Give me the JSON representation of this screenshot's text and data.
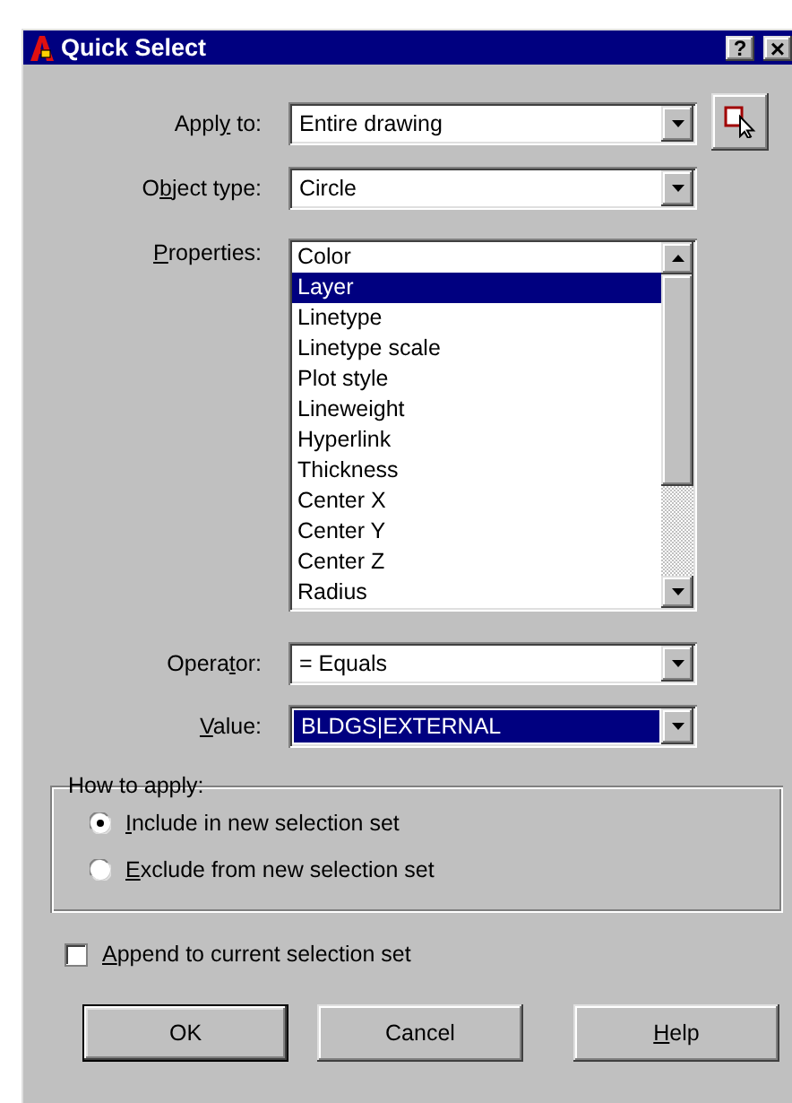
{
  "window": {
    "title": "Quick Select",
    "help_glyph": "?",
    "close_glyph": "×"
  },
  "fields": [
    {
      "kind": "combo",
      "label": [
        {
          "text": "Appl",
          "underline": false
        },
        {
          "text": "y",
          "underline": true
        },
        {
          "text": " to:",
          "underline": false
        }
      ],
      "value": "Entire drawing",
      "highlighted": false,
      "pick_button": true
    },
    {
      "kind": "combo",
      "label": [
        {
          "text": "O",
          "underline": false
        },
        {
          "text": "b",
          "underline": true
        },
        {
          "text": "ject type:",
          "underline": false
        }
      ],
      "value": "Circle",
      "highlighted": false,
      "pick_button": false
    },
    {
      "kind": "list",
      "label": [
        {
          "text": "P",
          "underline": true
        },
        {
          "text": "roperties:",
          "underline": false
        }
      ],
      "items": [
        {
          "text": "Color",
          "selected": false
        },
        {
          "text": "Layer",
          "selected": true
        },
        {
          "text": "Linetype",
          "selected": false
        },
        {
          "text": "Linetype scale",
          "selected": false
        },
        {
          "text": "Plot style",
          "selected": false
        },
        {
          "text": "Lineweight",
          "selected": false
        },
        {
          "text": "Hyperlink",
          "selected": false
        },
        {
          "text": "Thickness",
          "selected": false
        },
        {
          "text": "Center X",
          "selected": false
        },
        {
          "text": "Center Y",
          "selected": false
        },
        {
          "text": "Center Z",
          "selected": false
        },
        {
          "text": "Radius",
          "selected": false
        }
      ]
    },
    {
      "kind": "combo",
      "label": [
        {
          "text": "Opera",
          "underline": false
        },
        {
          "text": "t",
          "underline": true
        },
        {
          "text": "or:",
          "underline": false
        }
      ],
      "value": "= Equals",
      "highlighted": false,
      "pick_button": false
    },
    {
      "kind": "combo",
      "label": [
        {
          "text": "V",
          "underline": true
        },
        {
          "text": "alue:",
          "underline": false
        }
      ],
      "value": "BLDGS|EXTERNAL",
      "highlighted": true,
      "pick_button": false
    }
  ],
  "how_to_apply": {
    "title": "How to apply:",
    "options": [
      {
        "label": [
          {
            "text": "I",
            "underline": true
          },
          {
            "text": "nclude in new selection set",
            "underline": false
          }
        ],
        "selected": true
      },
      {
        "label": [
          {
            "text": "E",
            "underline": true
          },
          {
            "text": "xclude from new selection set",
            "underline": false
          }
        ],
        "selected": false
      }
    ]
  },
  "append": {
    "label": [
      {
        "text": "A",
        "underline": true
      },
      {
        "text": "ppend to current selection set",
        "underline": false
      }
    ],
    "checked": false
  },
  "buttons": [
    {
      "label": [
        {
          "text": "OK",
          "underline": false
        }
      ],
      "default": true
    },
    {
      "label": [
        {
          "text": "Cancel",
          "underline": false
        }
      ],
      "default": false
    },
    {
      "label": [
        {
          "text": "H",
          "underline": true
        },
        {
          "text": "elp",
          "underline": false
        }
      ],
      "default": false
    }
  ]
}
